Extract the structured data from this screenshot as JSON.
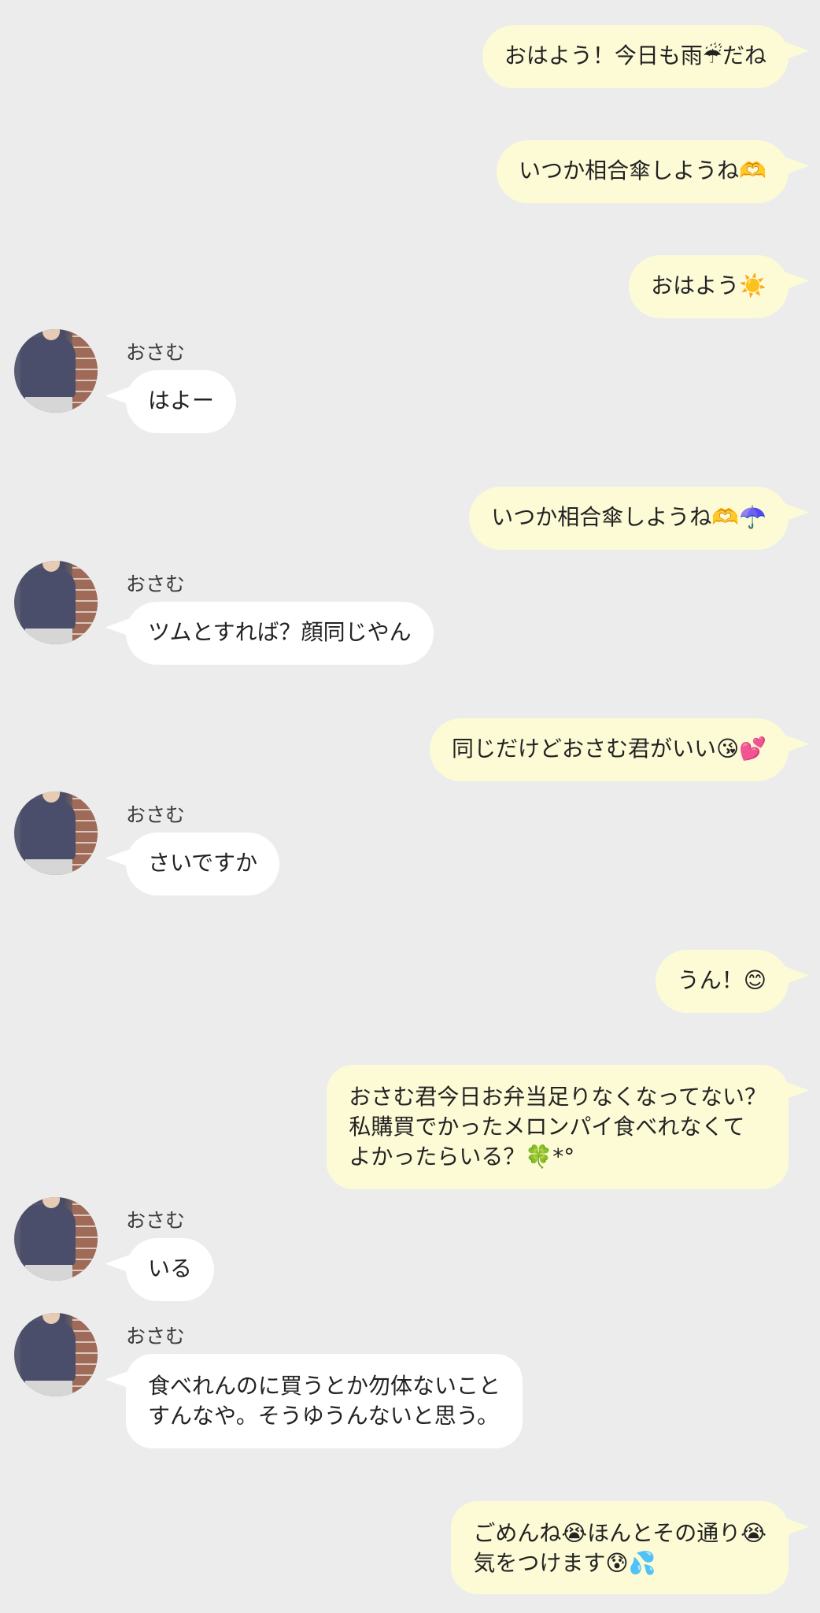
{
  "colors": {
    "background": "#ececec",
    "outgoing_bubble": "#fdfbd6",
    "incoming_bubble": "#ffffff"
  },
  "messages": [
    {
      "direction": "out",
      "lines": [
        "おはよう！今日も雨☔だね"
      ]
    },
    {
      "direction": "out",
      "lines": [
        "いつか相合傘しようね🫶"
      ]
    },
    {
      "direction": "out",
      "lines": [
        "おはよう☀️"
      ]
    },
    {
      "direction": "in",
      "sender": "おさむ",
      "lines": [
        "はよー"
      ]
    },
    {
      "direction": "out",
      "lines": [
        "いつか相合傘しようね🫶☂️"
      ]
    },
    {
      "direction": "in",
      "sender": "おさむ",
      "lines": [
        "ツムとすれば？顔同じやん"
      ]
    },
    {
      "direction": "out",
      "lines": [
        "同じだけどおさむ君がいい😘💕"
      ]
    },
    {
      "direction": "in",
      "sender": "おさむ",
      "lines": [
        "さいですか"
      ]
    },
    {
      "direction": "out",
      "lines": [
        "うん！😊"
      ]
    },
    {
      "direction": "out",
      "lines": [
        "おさむ君今日お弁当足りなくなってない？",
        "私購買でかったメロンパイ食べれなくて",
        "よかったらいる？🍀*°"
      ]
    },
    {
      "direction": "in",
      "sender": "おさむ",
      "lines": [
        "いる"
      ]
    },
    {
      "direction": "in",
      "sender": "おさむ",
      "lines": [
        "食べれんのに買うとか勿体ないこと",
        "すんなや。そうゆうんないと思う。"
      ]
    },
    {
      "direction": "out",
      "lines": [
        "ごめんね😭ほんとその通り😭",
        "気をつけます😰💦"
      ]
    }
  ]
}
